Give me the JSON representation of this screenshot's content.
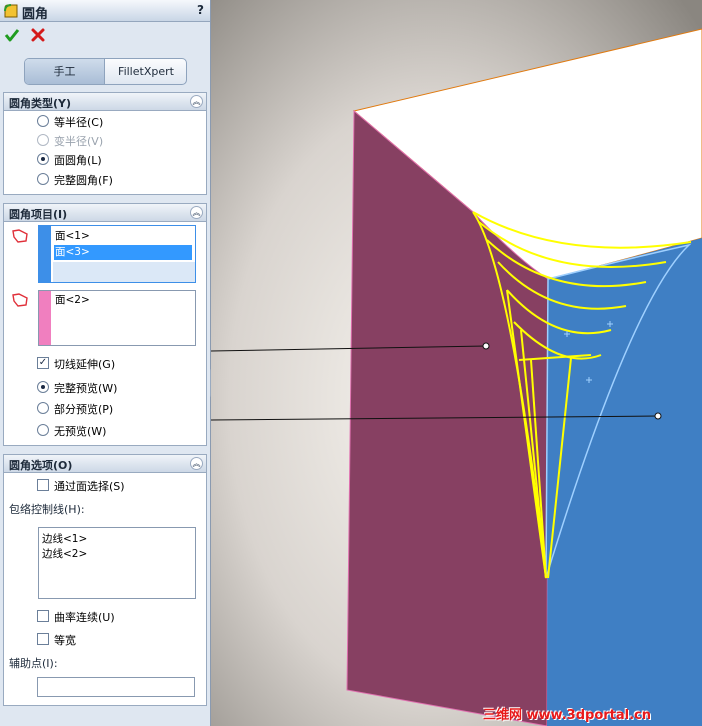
{
  "window": {
    "title": "圆角",
    "help": "?"
  },
  "actions": {
    "ok_icon": "checkmark-icon",
    "cancel_icon": "x-icon",
    "ok_color": "#1f9c1f",
    "cancel_color": "#d41a1a"
  },
  "modes": {
    "manual": "手工",
    "expert": "FilletXpert"
  },
  "fillet_type": {
    "title": "圆角类型(Y)",
    "options": [
      {
        "label": "等半径(C)",
        "selected": false,
        "enabled": true
      },
      {
        "label": "变半径(V)",
        "selected": false,
        "enabled": false
      },
      {
        "label": "面圆角(L)",
        "selected": true,
        "enabled": true
      },
      {
        "label": "完整圆角(F)",
        "selected": false,
        "enabled": true
      }
    ]
  },
  "fillet_items": {
    "title": "圆角项目(I)",
    "face_set_1": [
      "面<1>",
      "面<3>"
    ],
    "face_set_1_selected": "面<3>",
    "face_set_2": [
      "面<2>"
    ],
    "tangent_propagation": "切线延伸(G)",
    "preview_options": [
      {
        "label": "完整预览(W)",
        "selected": true
      },
      {
        "label": "部分预览(P)",
        "selected": false
      },
      {
        "label": "无预览(W)",
        "selected": false
      }
    ]
  },
  "fillet_options": {
    "title": "圆角选项(O)",
    "select_through_faces": "通过面选择(S)",
    "hold_line_label": "包络控制线(H):",
    "hold_lines": [
      "边线<1>",
      "边线<2>"
    ],
    "curvature_continuous": "曲率连续(U)",
    "constant_width": "等宽",
    "help_point_label": "辅助点(I):",
    "help_point_value": ""
  },
  "colors": {
    "face_set_1": "#3d8fe8",
    "face_set_2": "#f07fbf",
    "face_left": "#874062",
    "face_right": "#3f7fc4",
    "fillet_preview": "#ffff00"
  },
  "watermark": "三维网 www.3dportal.cn"
}
